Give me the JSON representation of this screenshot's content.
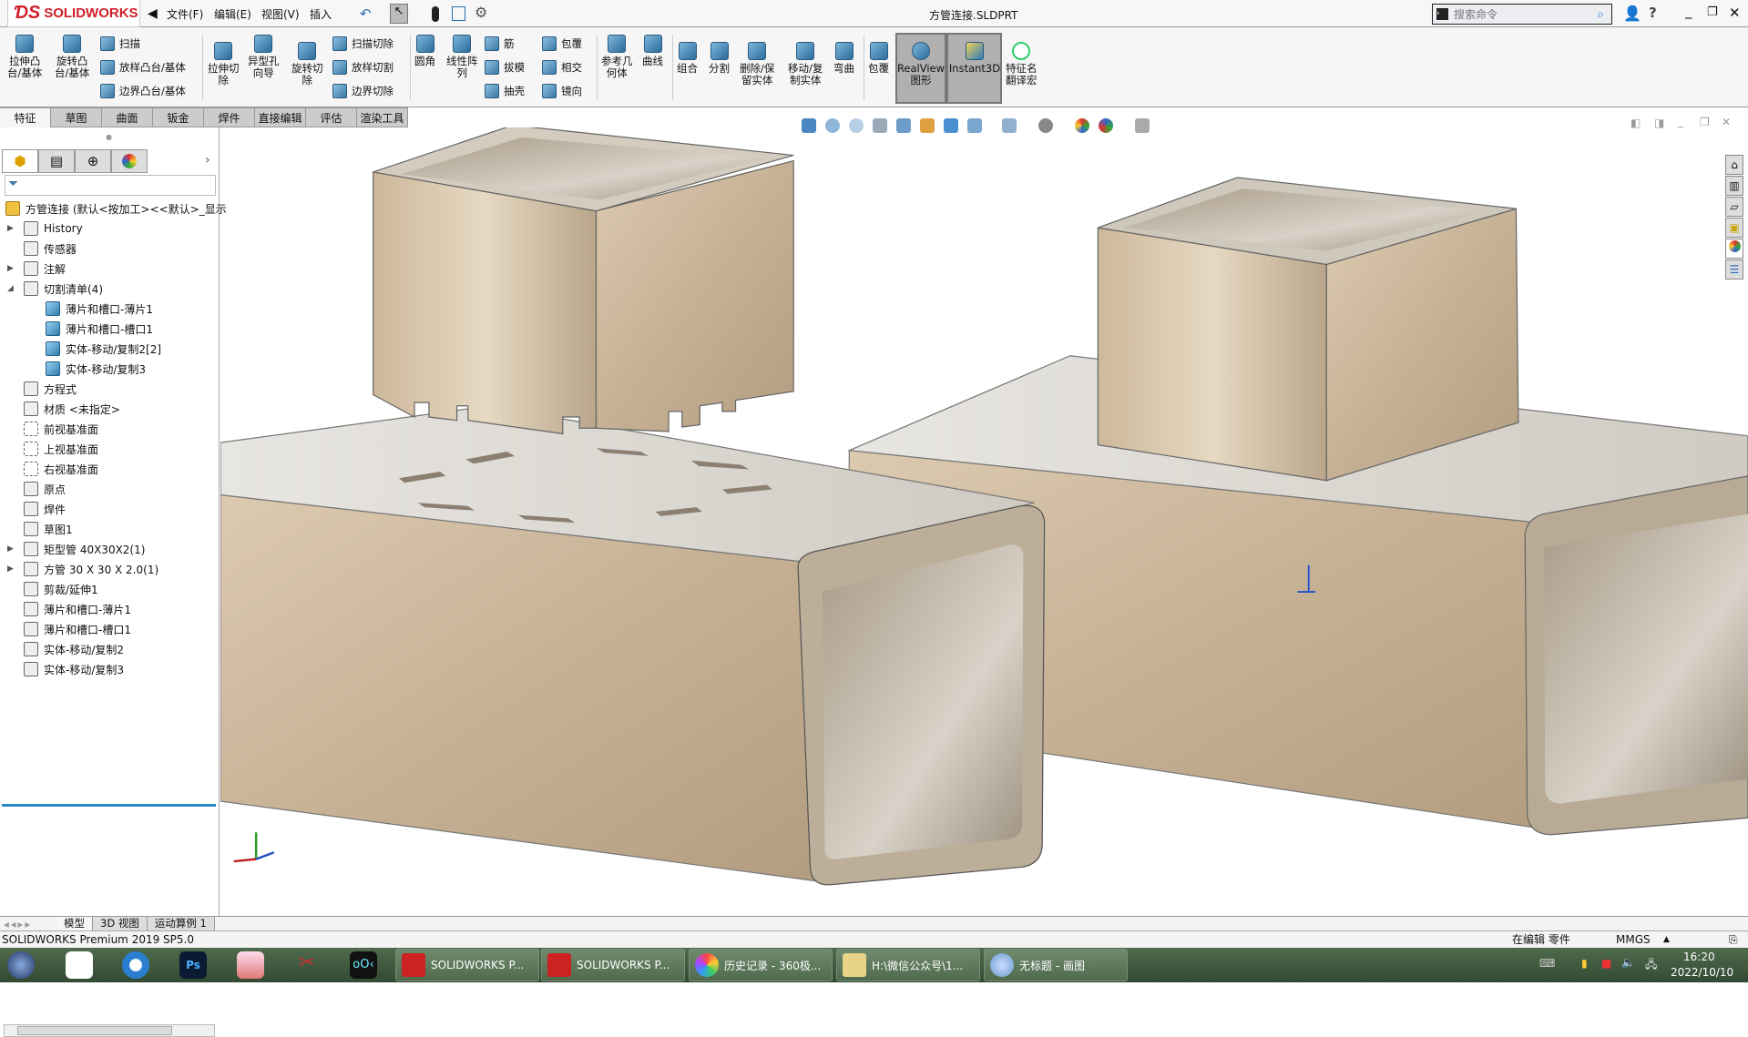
{
  "app": {
    "brand": "SOLIDWORKS",
    "title": "方管连接.SLDPRT",
    "search_placeholder": "搜索命令"
  },
  "menu": [
    "文件(F)",
    "编辑(E)",
    "视图(V)",
    "插入(I)"
  ],
  "menu_visible": [
    "文件(F)",
    "编辑(E)",
    "视图(V)",
    "插入"
  ],
  "ribbon": {
    "large": [
      "拉伸凸\n台/基体",
      "旋转凸\n台/基体",
      "拉伸切\n除",
      "异型孔\n向导",
      "旋转切\n除",
      "圆角",
      "线性阵\n列",
      "参考几\n何体",
      "曲线",
      "组合",
      "分割",
      "删除/保\n留实体",
      "移动/复\n制实体",
      "弯曲",
      "包覆",
      "RealView\n图形",
      "Instant3D",
      "特征名\n翻译宏"
    ],
    "small": [
      "扫描",
      "放样凸台/基体",
      "边界凸台/基体",
      "扫描切除",
      "放样切割",
      "边界切除",
      "筋",
      "拔模",
      "抽壳",
      "包覆",
      "相交",
      "镜向"
    ]
  },
  "tabs": [
    "特征",
    "草图",
    "曲面",
    "钣金",
    "焊件",
    "直接编辑",
    "评估",
    "渲染工具"
  ],
  "active_tab": "特征",
  "tree": {
    "root": "方管连接  (默认<按加工><<默认>_显示",
    "items": [
      {
        "label": "History",
        "level": 1,
        "expand": "right"
      },
      {
        "label": "传感器",
        "level": 1
      },
      {
        "label": "注解",
        "level": 1,
        "expand": "right"
      },
      {
        "label": "切割清单(4)",
        "level": 1,
        "expand": "down"
      },
      {
        "label": "薄片和槽口-薄片1",
        "level": 2,
        "icon": "cube"
      },
      {
        "label": "薄片和槽口-槽口1",
        "level": 2,
        "icon": "cube"
      },
      {
        "label": "实体-移动/复制2[2]",
        "level": 2,
        "icon": "cube"
      },
      {
        "label": "实体-移动/复制3",
        "level": 2,
        "icon": "cube"
      },
      {
        "label": "方程式",
        "level": 1
      },
      {
        "label": "材质 <未指定>",
        "level": 1
      },
      {
        "label": "前视基准面",
        "level": 1,
        "icon": "plane"
      },
      {
        "label": "上视基准面",
        "level": 1,
        "icon": "plane"
      },
      {
        "label": "右视基准面",
        "level": 1,
        "icon": "plane"
      },
      {
        "label": "原点",
        "level": 1
      },
      {
        "label": "焊件",
        "level": 1
      },
      {
        "label": "草图1",
        "level": 1
      },
      {
        "label": "矩型管 40X30X2(1)",
        "level": 1,
        "expand": "right"
      },
      {
        "label": "方管 30 X 30 X 2.0(1)",
        "level": 1,
        "expand": "right"
      },
      {
        "label": "剪裁/延伸1",
        "level": 1
      },
      {
        "label": "薄片和槽口-薄片1",
        "level": 1
      },
      {
        "label": "薄片和槽口-槽口1",
        "level": 1
      },
      {
        "label": "实体-移动/复制2",
        "level": 1
      },
      {
        "label": "实体-移动/复制3",
        "level": 1
      }
    ]
  },
  "bottom_tabs": [
    "模型",
    "3D 视图",
    "运动算例 1"
  ],
  "status": {
    "left": "SOLIDWORKS Premium 2019 SP5.0",
    "mode": "在编辑 零件",
    "units": "MMGS"
  },
  "taskbar": {
    "tasks": [
      "SOLIDWORKS P...",
      "SOLIDWORKS P...",
      "历史记录 - 360极...",
      "H:\\微信公众号\\1...",
      "无标题 - 画图"
    ],
    "time": "16:20",
    "date": "2022/10/10"
  },
  "colors": {
    "brand": "#d0202a",
    "selection": "#2d88c8",
    "metal": "#c9b89e"
  }
}
